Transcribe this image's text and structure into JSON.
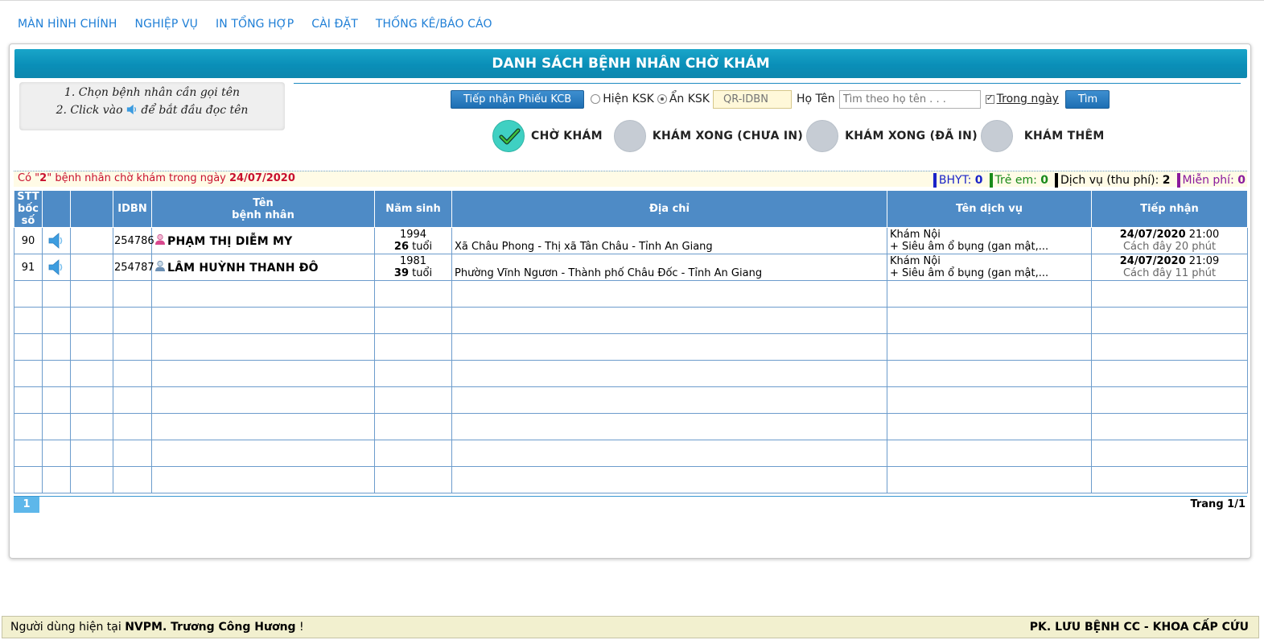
{
  "nav": {
    "items": [
      "MÀN HÌNH CHÍNH",
      "NGHIỆP VỤ",
      "IN TỔNG HỢP",
      "CÀI ĐẶT",
      "THỐNG KÊ/BÁO CÁO"
    ]
  },
  "banner": {
    "title": "DANH SÁCH BỆNH NHÂN CHỜ KHÁM"
  },
  "hint": {
    "line1": "1. Chọn bệnh nhân cần gọi tên",
    "line2_pre": "2. Click vào",
    "line2_post": "để bắt đầu đọc tên"
  },
  "toolbar": {
    "receive_button": "Tiếp nhận Phiếu KCB",
    "show_ksk": "Hiện KSK",
    "hide_ksk": "Ẩn KSK",
    "qr_placeholder": "QR-IDBN",
    "name_label": "Họ Tên",
    "name_placeholder": "Tìm theo họ tên . . .",
    "today_label": "Trong ngày",
    "today_checked": true,
    "hide_ksk_selected": true,
    "search_button": "Tìm"
  },
  "statuses": [
    {
      "label": "CHỜ KHÁM",
      "active": true
    },
    {
      "label": "KHÁM XONG (CHƯA IN)",
      "active": false
    },
    {
      "label": "KHÁM XONG (ĐÃ IN)",
      "active": false
    },
    {
      "label": "KHÁM THÊM",
      "active": false
    }
  ],
  "summary": {
    "prefix": "Có \"",
    "count": "2",
    "middle": "\" bệnh nhân chờ khám trong ngày ",
    "date": "24/07/2020",
    "bhyt_label": "BHYT:",
    "bhyt": "0",
    "child_label": "Trẻ em:",
    "child": "0",
    "service_label": "Dịch vụ (thu phí):",
    "service": "2",
    "free_label": "Miễn phí:",
    "free": "0",
    "colors": {
      "bhyt": "#1a23c8",
      "child": "#1a8a1a",
      "service": "#000000",
      "free": "#8b1a9c"
    }
  },
  "table": {
    "headers": {
      "stt_line1": "STT",
      "stt_line2": "bốc số",
      "idbn": "IDBN",
      "name_line1": "Tên",
      "name_line2": "bệnh nhân",
      "dob": "Năm sinh",
      "address": "Địa chỉ",
      "service": "Tên dịch vụ",
      "received": "Tiếp nhận"
    },
    "rows": [
      {
        "stt": "90",
        "idbn": "254786",
        "name": "PHẠM THỊ DIỄM MY",
        "gender_icon": "female-user-icon",
        "year": "1994",
        "age": "26",
        "age_unit": "tuổi",
        "address": "Xã Châu Phong - Thị xã Tân Châu - Tỉnh An Giang",
        "service_line1": "Khám Nội",
        "service_line2": "+ Siêu âm ổ bụng (gan mật,...",
        "recv_date": "24/07/2020",
        "recv_time": "21:00",
        "recv_ago": "Cách đây 20 phút"
      },
      {
        "stt": "91",
        "idbn": "254787",
        "name": "LÂM HUỲNH THANH ĐÔ",
        "gender_icon": "male-user-icon",
        "year": "1981",
        "age": "39",
        "age_unit": "tuổi",
        "address": "Phường Vĩnh Ngươn - Thành phố Châu Đốc - Tỉnh An Giang",
        "service_line1": "Khám Nội",
        "service_line2": "+ Siêu âm ổ bụng (gan mật,...",
        "recv_date": "24/07/2020",
        "recv_time": "21:09",
        "recv_ago": "Cách đây 11 phút"
      }
    ]
  },
  "pager": {
    "current": "1",
    "info": "Trang 1/1"
  },
  "footer": {
    "user_prefix": "Người dùng hiện tại",
    "user_name": "NVPM. Trương Công Hương",
    "user_suffix": "!",
    "department": "PK. LƯU BỆNH CC - KHOA CẤP CỨU"
  }
}
